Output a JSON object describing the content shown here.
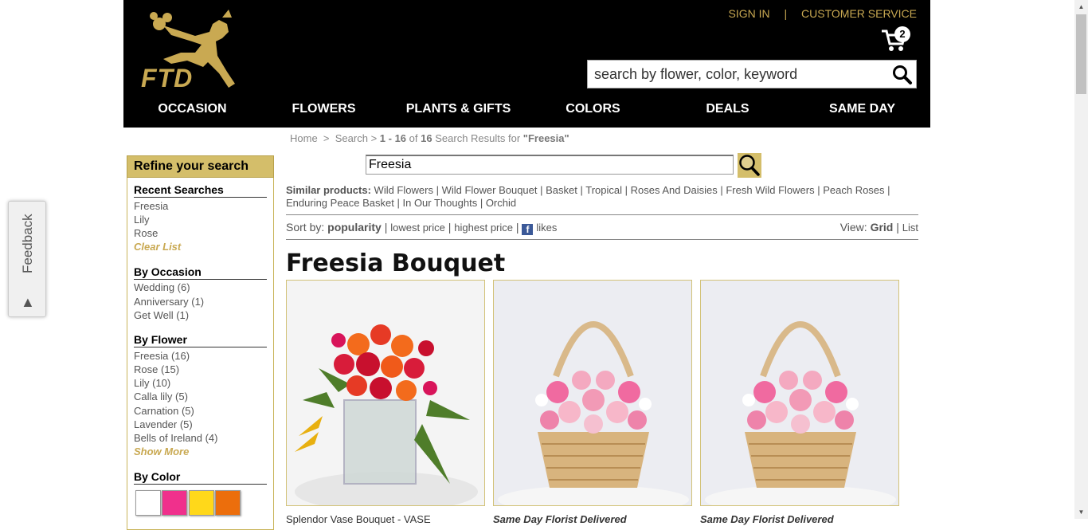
{
  "header": {
    "logo_text": "FTD",
    "sign_in": "SIGN IN",
    "separator": "|",
    "customer_service": "CUSTOMER SERVICE",
    "cart_count": "2",
    "search_placeholder": "search by flower, color, keyword",
    "nav": [
      "OCCASION",
      "FLOWERS",
      "PLANTS & GIFTS",
      "COLORS",
      "DEALS",
      "SAME DAY"
    ]
  },
  "breadcrumb": {
    "home": "Home",
    "sep": ">",
    "search": "Search",
    "range": "1 - 16",
    "of": "of",
    "total": "16",
    "label": "Search Results for",
    "query": "\"Freesia\""
  },
  "sidebar": {
    "refine": "Refine your search",
    "recent_title": "Recent Searches",
    "recent": [
      "Freesia",
      "Lily",
      "Rose"
    ],
    "clear_list": "Clear List",
    "occasion_title": "By Occasion",
    "occasion": [
      "Wedding (6)",
      "Anniversary (1)",
      "Get Well (1)"
    ],
    "flower_title": "By Flower",
    "flower": [
      "Freesia (16)",
      "Rose (15)",
      "Lily (10)",
      "Calla lily (5)",
      "Carnation (5)",
      "Lavender (5)",
      "Bells of Ireland (4)"
    ],
    "show_more": "Show More",
    "color_title": "By Color",
    "colors": [
      "#ffffff",
      "#f0308c",
      "#ffd81a",
      "#ec6e0c"
    ]
  },
  "feedback": "Feedback",
  "main": {
    "search_value": "Freesia",
    "similar_label": "Similar products:",
    "similar": [
      "Wild Flowers",
      "Wild Flower Bouquet",
      "Basket",
      "Tropical",
      "Roses And Daisies",
      "Fresh Wild Flowers",
      "Peach Roses",
      "Enduring Peace Basket",
      "In Our Thoughts",
      "Orchid"
    ],
    "sort_label": "Sort by:",
    "sort_popularity": "popularity",
    "sort_lowest": "lowest price",
    "sort_highest": "highest price",
    "sort_likes": "likes",
    "view_label": "View:",
    "view_grid": "Grid",
    "view_list": "List",
    "heading": "Freesia Bouquet",
    "products": [
      {
        "name": "Splendor Vase Bouquet - VASE"
      },
      {
        "name": "Same Day Florist Delivered"
      },
      {
        "name": "Same Day Florist Delivered"
      }
    ]
  }
}
